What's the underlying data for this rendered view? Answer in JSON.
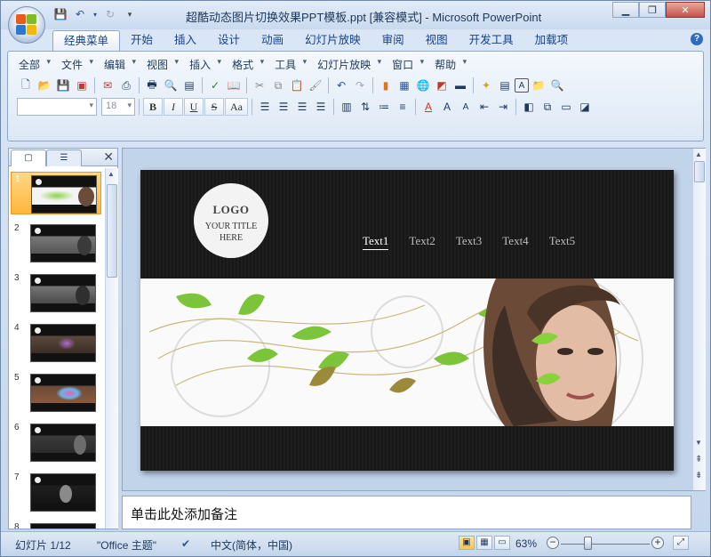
{
  "window": {
    "title": "超酷动态图片切换效果PPT模板.ppt [兼容模式] - Microsoft PowerPoint"
  },
  "ribbon_tabs": [
    "经典菜单",
    "开始",
    "插入",
    "设计",
    "动画",
    "幻灯片放映",
    "审阅",
    "视图",
    "开发工具",
    "加载项"
  ],
  "classic_menus": [
    "全部",
    "文件",
    "编辑",
    "视图",
    "插入",
    "格式",
    "工具",
    "幻灯片放映",
    "窗口",
    "帮助"
  ],
  "format": {
    "font_size": "18",
    "bold": "B",
    "italic": "I",
    "underline": "U",
    "strike": "S",
    "case": "Aa"
  },
  "slides_pane": {
    "slide_numbers": [
      "1",
      "2",
      "3",
      "4",
      "5",
      "6",
      "7",
      "8"
    ],
    "selected": 1
  },
  "slide": {
    "logo_line1": "LOGO",
    "logo_line2": "YOUR TITLE",
    "logo_line3": "HERE",
    "nav": [
      "Text1",
      "Text2",
      "Text3",
      "Text4",
      "Text5"
    ]
  },
  "notes": {
    "placeholder": "单击此处添加备注"
  },
  "status": {
    "slide_info": "幻灯片 1/12",
    "theme": "\"Office 主题\"",
    "language": "中文(简体，中国)",
    "zoom": "63%"
  },
  "colors": {
    "selected_thumb": "#ffb53c",
    "accent": "#15428b"
  }
}
